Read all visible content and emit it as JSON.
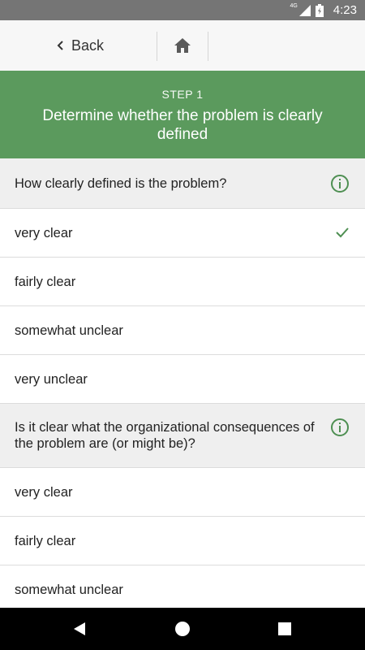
{
  "status_bar": {
    "network": "4G",
    "time": "4:23",
    "icons": [
      "signal-icon",
      "battery-icon"
    ]
  },
  "top_bar": {
    "back_label": "Back",
    "icons": [
      "chevron-left-icon",
      "home-icon"
    ]
  },
  "step": {
    "label": "STEP 1",
    "title": "Determine whether the problem is clearly defined"
  },
  "questions": [
    {
      "text": "How clearly defined is the problem?",
      "options": [
        {
          "label": "very clear",
          "selected": true
        },
        {
          "label": "fairly clear",
          "selected": false
        },
        {
          "label": "somewhat unclear",
          "selected": false
        },
        {
          "label": "very unclear",
          "selected": false
        }
      ]
    },
    {
      "text": "Is it clear what the organizational consequences of the problem are (or might be)?",
      "options": [
        {
          "label": "very clear",
          "selected": false
        },
        {
          "label": "fairly clear",
          "selected": false
        },
        {
          "label": "somewhat unclear",
          "selected": false
        }
      ]
    }
  ],
  "colors": {
    "accent": "#5b9a5d",
    "status_bar": "#757575",
    "question_bg": "#efefef",
    "nav_bar": "#000000"
  },
  "nav_bar": {
    "icons": [
      "back-triangle-icon",
      "home-circle-icon",
      "recents-square-icon"
    ]
  }
}
